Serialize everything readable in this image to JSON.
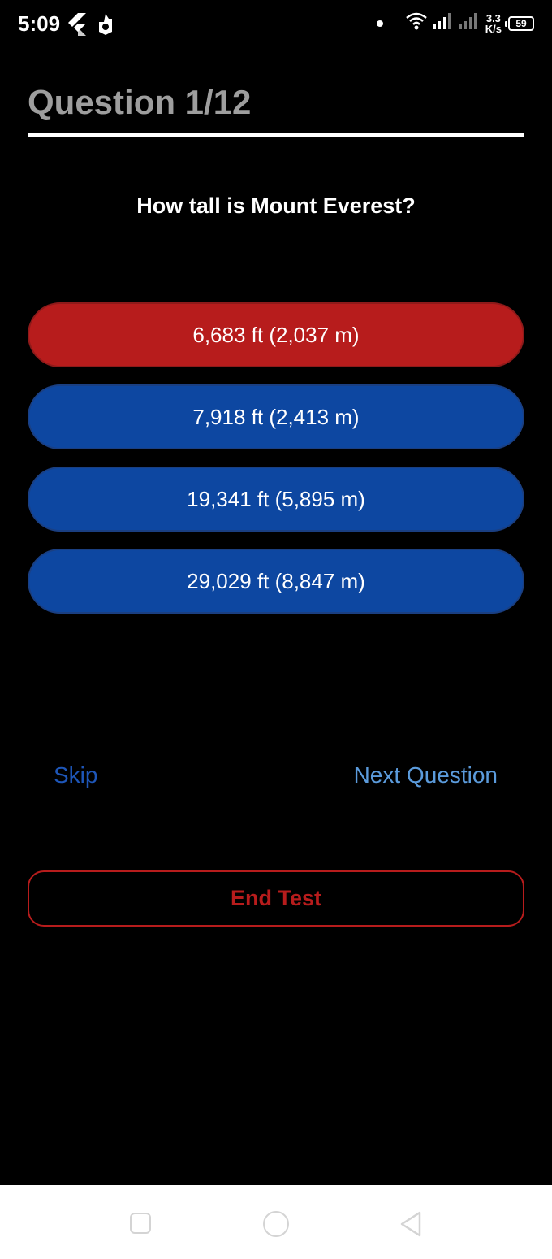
{
  "status_bar": {
    "time": "5:09",
    "speed_value": "3.3",
    "speed_unit": "K/s",
    "battery": "59",
    "icons": [
      "flutter-icon",
      "notification-app-icon",
      "dot-icon",
      "wifi-icon",
      "signal-icon",
      "signal-icon-2",
      "battery-icon"
    ]
  },
  "quiz": {
    "counter": "Question 1/12",
    "question": "How tall is Mount Everest?",
    "answers": [
      {
        "label": "6,683 ft (2,037 m)",
        "state": "wrong",
        "color": "#b71c1c"
      },
      {
        "label": "7,918 ft (2,413 m)",
        "state": "default",
        "color": "#0d47a1"
      },
      {
        "label": "19,341 ft (5,895 m)",
        "state": "default",
        "color": "#0d47a1"
      },
      {
        "label": "29,029 ft (8,847 m)",
        "state": "default",
        "color": "#0d47a1"
      }
    ],
    "skip_label": "Skip",
    "next_label": "Next Question",
    "end_label": "End Test"
  },
  "nav_bar": {
    "icons": [
      "recents-icon",
      "home-icon",
      "back-icon"
    ]
  }
}
